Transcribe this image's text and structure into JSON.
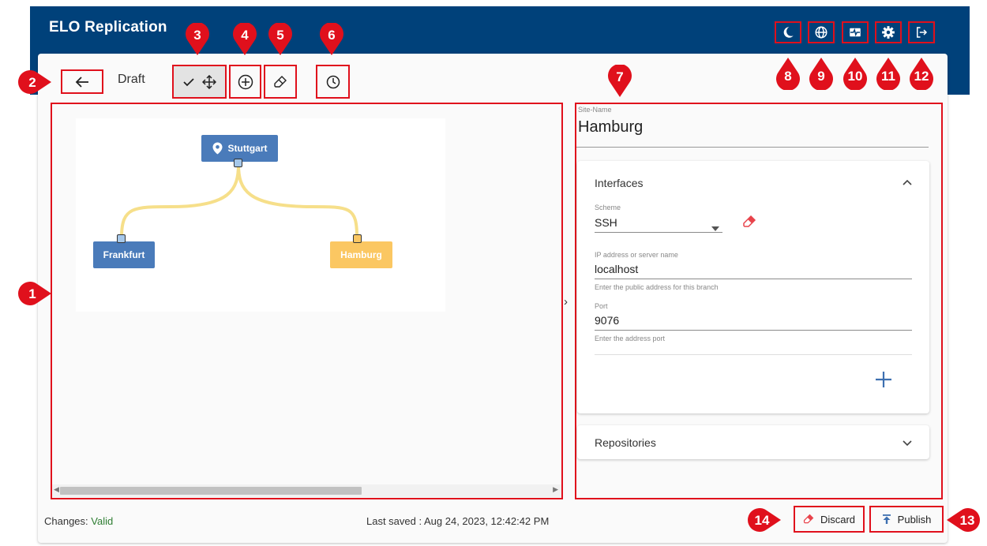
{
  "app": {
    "title": "ELO Replication"
  },
  "toolbar": {
    "draft_label": "Draft"
  },
  "diagram": {
    "nodes": {
      "stuttgart": "Stuttgart",
      "frankfurt": "Frankfurt",
      "hamburg": "Hamburg"
    },
    "colors": {
      "node_blue": "#4a7bba",
      "node_selected": "#fbc762",
      "link": "#f6df8a"
    }
  },
  "details": {
    "site_label": "Site-Name",
    "site_name": "Hamburg",
    "interfaces": {
      "title": "Interfaces",
      "scheme_label": "Scheme",
      "scheme_value": "SSH",
      "address_label": "IP address or server name",
      "address_value": "localhost",
      "address_hint": "Enter the public address for this branch",
      "port_label": "Port",
      "port_value": "9076",
      "port_hint": "Enter the address port"
    },
    "repositories": {
      "title": "Repositories"
    }
  },
  "footer": {
    "changes_label": "Changes:",
    "changes_value": "Valid",
    "last_saved": "Last saved : Aug 24, 2023, 12:42:42 PM",
    "discard": "Discard",
    "publish": "Publish"
  },
  "markers": [
    "1",
    "2",
    "3",
    "4",
    "5",
    "6",
    "7",
    "8",
    "9",
    "10",
    "11",
    "12",
    "13",
    "14"
  ],
  "colors": {
    "header": "#00417a",
    "highlight": "#e0101c",
    "valid": "#2e7d32"
  }
}
